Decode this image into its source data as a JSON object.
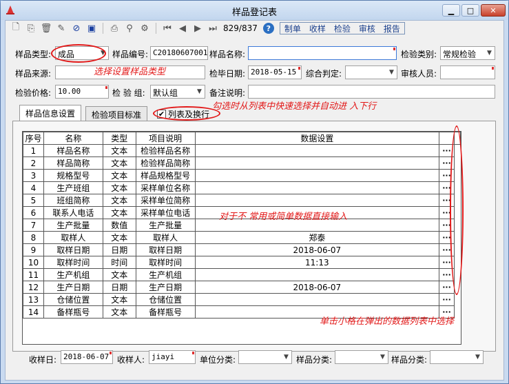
{
  "window": {
    "title": "样品登记表"
  },
  "toolbar": {
    "record_position": "829/837",
    "menu": [
      "制单",
      "收样",
      "检验",
      "审核",
      "报告"
    ]
  },
  "form": {
    "sample_type": {
      "label": "样品类型:",
      "value": "成品"
    },
    "sample_no": {
      "label": "样品编号:",
      "value": "C20180607001"
    },
    "sample_name": {
      "label": "样品名称:",
      "value": ""
    },
    "inspect_category": {
      "label": "检验类别:",
      "value": "常规检验"
    },
    "sample_source": {
      "label": "样品来源:",
      "value": ""
    },
    "finish_date": {
      "label": "检毕日期:",
      "value": "2018-05-15"
    },
    "overall_judgement": {
      "label": "综合判定:",
      "value": ""
    },
    "reviewer": {
      "label": "审核人员:",
      "value": ""
    },
    "inspect_price": {
      "label": "检验价格:",
      "value": "10.00"
    },
    "inspect_group": {
      "label": "检 验 组:",
      "value": "默认组"
    },
    "remark": {
      "label": "备注说明:",
      "value": ""
    }
  },
  "tabs": [
    "样品信息设置",
    "检验项目标准"
  ],
  "list_checkbox": {
    "label": "列表及换行",
    "checked": true
  },
  "annotations": {
    "select_type": "选择设置样品类型",
    "checkbox_hint": "勾选时从列表中快速选择并自动进 入下行",
    "direct_input": "对于不 常用或简单数据直接输入",
    "click_cell": "单击小格在弹出的数据列表中选择"
  },
  "grid": {
    "headers": [
      "序号",
      "名称",
      "类型",
      "项目说明",
      "数据设置"
    ],
    "button_label": "···",
    "rows": [
      [
        "1",
        "样品名称",
        "文本",
        "检验样品名称",
        ""
      ],
      [
        "2",
        "样品简称",
        "文本",
        "检验样品简称",
        ""
      ],
      [
        "3",
        "规格型号",
        "文本",
        "样品规格型号",
        ""
      ],
      [
        "4",
        "生产班组",
        "文本",
        "采样单位名称",
        ""
      ],
      [
        "5",
        "班组简称",
        "文本",
        "采样单位简称",
        ""
      ],
      [
        "6",
        "联系人电话",
        "文本",
        "采样单位电话",
        ""
      ],
      [
        "7",
        "生产批量",
        "数值",
        "生产批量",
        ""
      ],
      [
        "8",
        "取样人",
        "文本",
        "取样人",
        "郑泰"
      ],
      [
        "9",
        "取样日期",
        "日期",
        "取样日期",
        "2018-06-07"
      ],
      [
        "10",
        "取样时间",
        "时间",
        "取样时间",
        "11:13"
      ],
      [
        "11",
        "生产机组",
        "文本",
        "生产机组",
        ""
      ],
      [
        "12",
        "生产日期",
        "日期",
        "生产日期",
        "2018-06-07"
      ],
      [
        "13",
        "仓储位置",
        "文本",
        "仓储位置",
        ""
      ],
      [
        "14",
        "备样瓶号",
        "文本",
        "备样瓶号",
        ""
      ]
    ]
  },
  "bottom": {
    "receive_date": {
      "label": "收样日:",
      "value": "2018-06-07"
    },
    "receiver": {
      "label": "收样人:",
      "value": "jiayi"
    },
    "unit_class": {
      "label": "单位分类:",
      "value": ""
    },
    "sample_class1": {
      "label": "样品分类:",
      "value": ""
    },
    "sample_class2": {
      "label": "样品分类:",
      "value": ""
    }
  },
  "colors": {
    "annotation": "#e21818",
    "menu_text": "#1a3f8c"
  }
}
